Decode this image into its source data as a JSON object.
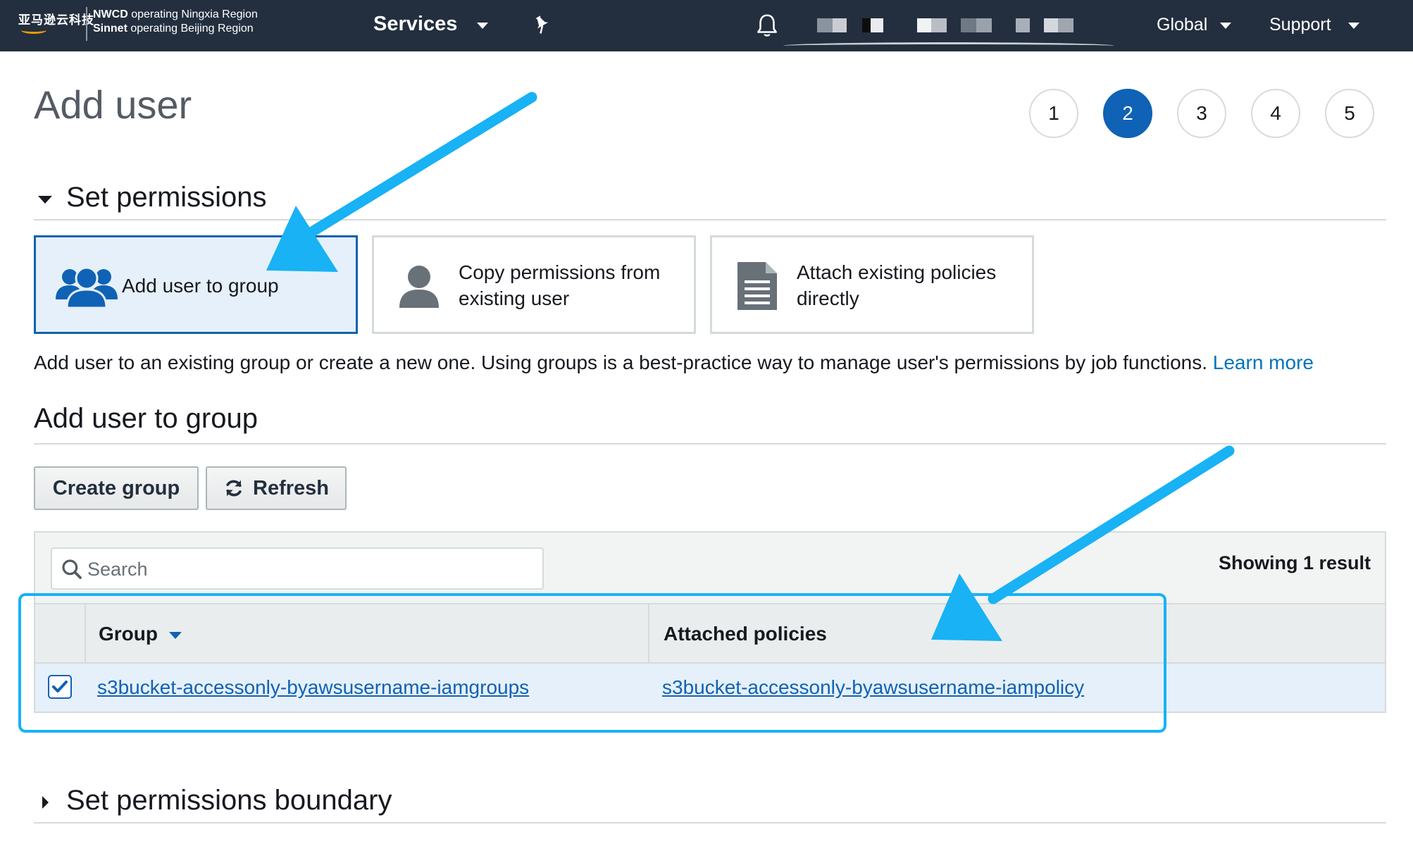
{
  "nav": {
    "logo_text": "亚马逊云科技",
    "region_line1_bold": "NWCD",
    "region_line1_rest": " operating Ningxia Region",
    "region_line2_bold": "Sinnet",
    "region_line2_rest": " operating Beijing Region",
    "services": "Services",
    "global": "Global",
    "support": "Support"
  },
  "page": {
    "title": "Add user"
  },
  "steps": [
    "1",
    "2",
    "3",
    "4",
    "5"
  ],
  "active_step": "2",
  "permissions": {
    "heading": "Set permissions",
    "options": [
      {
        "label": "Add user to group",
        "icon": "group-icon",
        "selected": true
      },
      {
        "label_line1": "Copy permissions from",
        "label_line2": "existing user",
        "icon": "user-icon",
        "selected": false
      },
      {
        "label_line1": "Attach existing policies",
        "label_line2": "directly",
        "icon": "document-icon",
        "selected": false
      }
    ],
    "description": "Add user to an existing group or create a new one. Using groups is a best-practice way to manage user's permissions by job functions.",
    "learn_more": "Learn more"
  },
  "group_section": {
    "heading": "Add user to group",
    "create_button": "Create group",
    "refresh_button": "Refresh",
    "search_placeholder": "Search",
    "showing": "Showing 1 result",
    "columns": {
      "group": "Group",
      "policies": "Attached policies"
    },
    "rows": [
      {
        "checked": true,
        "group": "s3bucket-accessonly-byawsusername-iamgroups",
        "policy": "s3bucket-accessonly-byawsusername-iampolicy"
      }
    ]
  },
  "boundary": {
    "heading": "Set permissions boundary"
  },
  "colors": {
    "nav_bg": "#232f3e",
    "primary": "#0f62b5",
    "link": "#0073bb",
    "annotation": "#18b2f5",
    "selected_bg": "#e6f0fa"
  }
}
